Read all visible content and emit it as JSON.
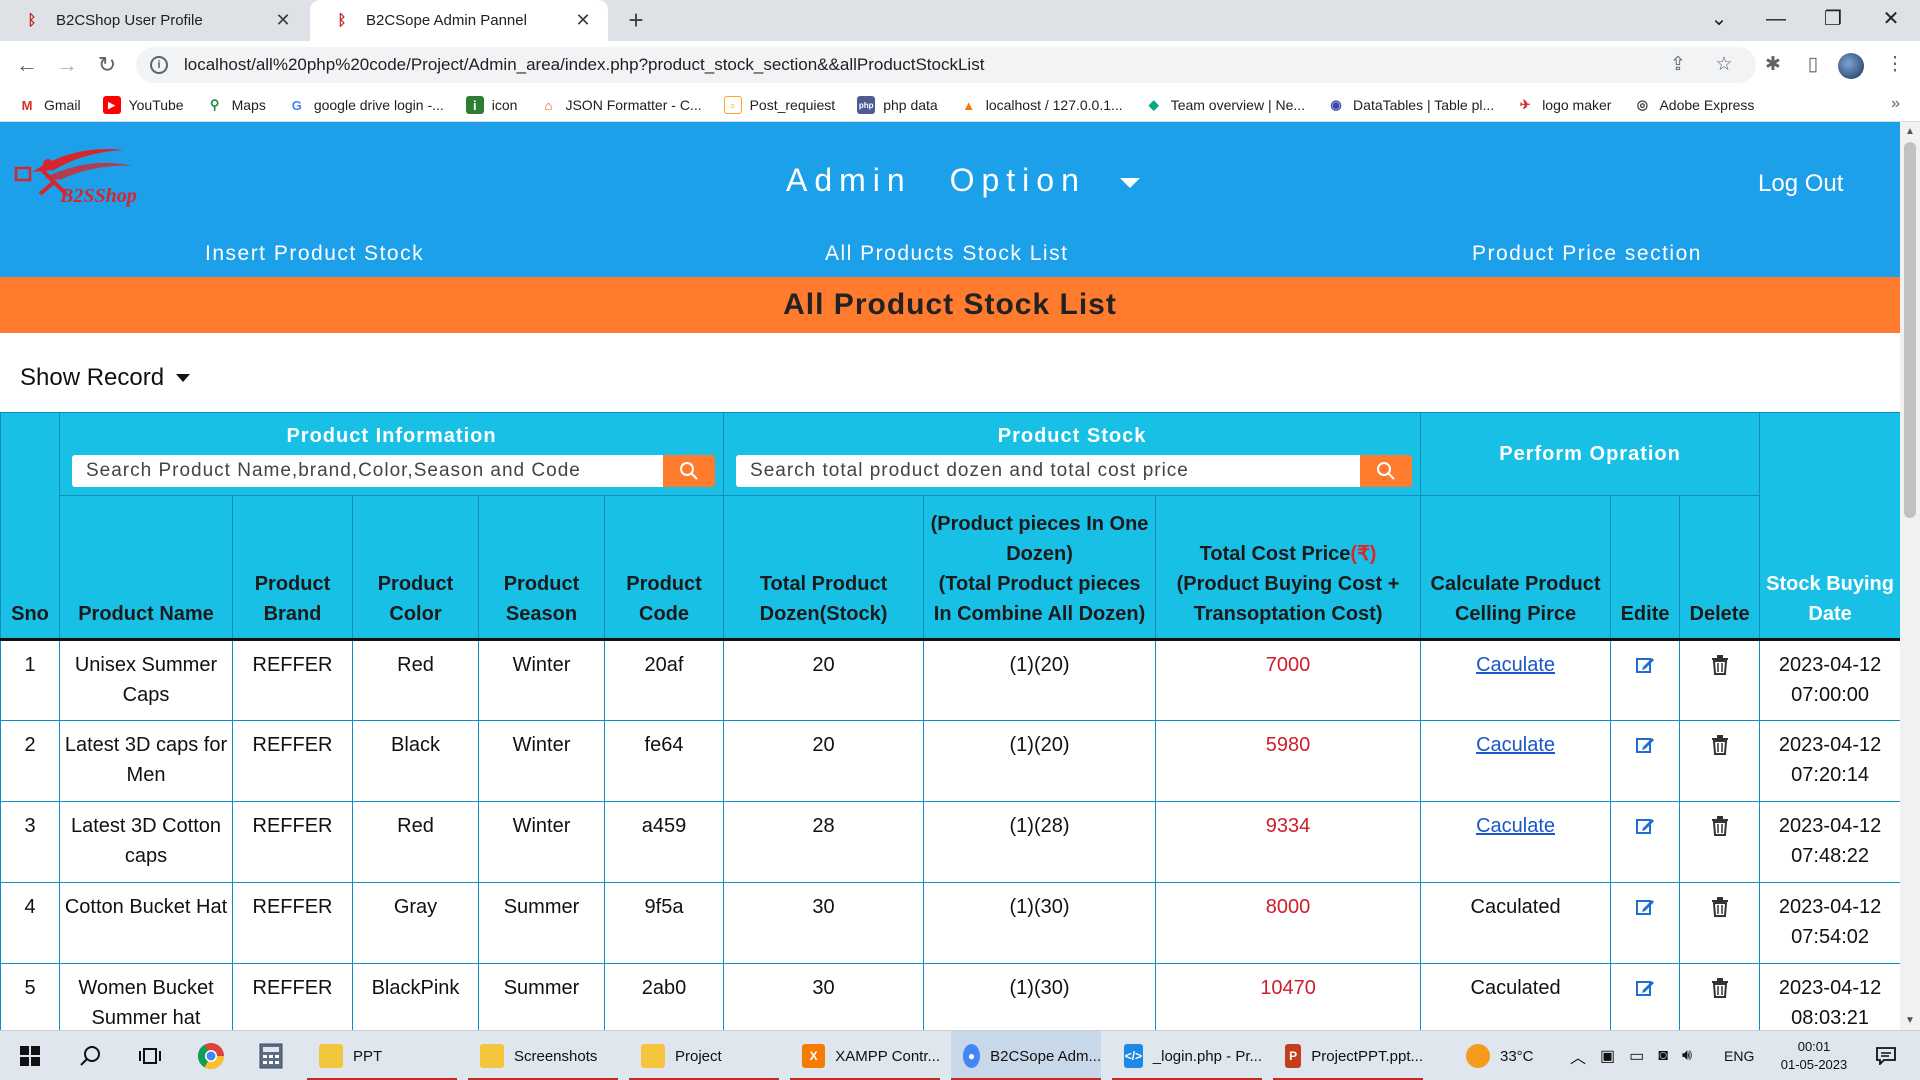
{
  "browser": {
    "tabs": [
      {
        "title": "B2CShop User Profile"
      },
      {
        "title": "B2CSope Admin Pannel"
      }
    ],
    "url": "localhost/all%20php%20code/Project/Admin_area/index.php?product_stock_section&&allProductStockList",
    "bookmarks": [
      "Gmail",
      "YouTube",
      "Maps",
      "google drive login -...",
      "icon",
      "JSON Formatter - C...",
      "Post_requiest",
      "php data",
      "localhost / 127.0.0.1...",
      "Team overview | Ne...",
      "DataTables | Table pl...",
      "logo maker",
      "Adobe Express"
    ]
  },
  "header": {
    "admin_option": "Admin Option",
    "logout": "Log Out",
    "nav": [
      "Insert Product Stock",
      "All Products Stock List",
      "Product Price section"
    ],
    "logo_text": "B2SShop"
  },
  "page_title": "All Product Stock List",
  "show_record": "Show Record",
  "table": {
    "groups": {
      "product_info": "Product Information",
      "product_stock": "Product Stock",
      "perform": "Perform Opration"
    },
    "search": {
      "info_placeholder": "Search Product Name,brand,Color,Season and Code",
      "stock_placeholder": "Search total product dozen and total cost price"
    },
    "headers": {
      "sno": "Sno",
      "name": "Product Name",
      "brand": "Product Brand",
      "color": "Product Color",
      "season": "Product Season",
      "code": "Product Code",
      "dozen": "Total Product Dozen(Stock)",
      "pieces_1": "(Product pieces In One Dozen)",
      "pieces_2": "(Total Product pieces In Combine All Dozen)",
      "cost_1": "Total Cost Price",
      "cost_symbol": "(₹)",
      "cost_2": "(Product Buying Cost + Transoptation Cost)",
      "calc": "Calculate Product Celling Pirce",
      "edit": "Edite",
      "delete": "Delete",
      "date": "Stock Buying Date"
    },
    "rows": [
      {
        "sno": "1",
        "name": "Unisex Summer Caps",
        "brand": "REFFER",
        "color": "Red",
        "season": "Winter",
        "code": "20af",
        "dozen": "20",
        "pieces": "(1)(20)",
        "cost": "7000",
        "calc": "Caculate",
        "calc_link": true,
        "date": "2023-04-12",
        "time": "07:00:00"
      },
      {
        "sno": "2",
        "name": "Latest 3D caps for Men",
        "brand": "REFFER",
        "color": "Black",
        "season": "Winter",
        "code": "fe64",
        "dozen": "20",
        "pieces": "(1)(20)",
        "cost": "5980",
        "calc": "Caculate",
        "calc_link": true,
        "date": "2023-04-12",
        "time": "07:20:14"
      },
      {
        "sno": "3",
        "name": "Latest 3D Cotton caps",
        "brand": "REFFER",
        "color": "Red",
        "season": "Winter",
        "code": "a459",
        "dozen": "28",
        "pieces": "(1)(28)",
        "cost": "9334",
        "calc": "Caculate",
        "calc_link": true,
        "date": "2023-04-12",
        "time": "07:48:22"
      },
      {
        "sno": "4",
        "name": "Cotton Bucket Hat",
        "brand": "REFFER",
        "color": "Gray",
        "season": "Summer",
        "code": "9f5a",
        "dozen": "30",
        "pieces": "(1)(30)",
        "cost": "8000",
        "calc": "Caculated",
        "calc_link": false,
        "date": "2023-04-12",
        "time": "07:54:02"
      },
      {
        "sno": "5",
        "name": "Women Bucket Summer hat",
        "brand": "REFFER",
        "color": "BlackPink",
        "season": "Summer",
        "code": "2ab0",
        "dozen": "30",
        "pieces": "(1)(30)",
        "cost": "10470",
        "calc": "Caculated",
        "calc_link": false,
        "date": "2023-04-12",
        "time": "08:03:21"
      }
    ]
  },
  "taskbar": {
    "apps": [
      "PPT",
      "Screenshots",
      "Project",
      "XAMPP Contr...",
      "B2CSope Adm...",
      "_login.php - Pr...",
      "ProjectPPT.ppt..."
    ],
    "weather": "33°C",
    "lang": "ENG",
    "time": "00:01",
    "date": "01-05-2023"
  },
  "colors": {
    "header_blue": "#1da0ea",
    "orange": "#ff7c2e",
    "table_cyan": "#18c0e6",
    "cost_red": "#cc1f2c",
    "link_blue": "#1a56c9"
  }
}
